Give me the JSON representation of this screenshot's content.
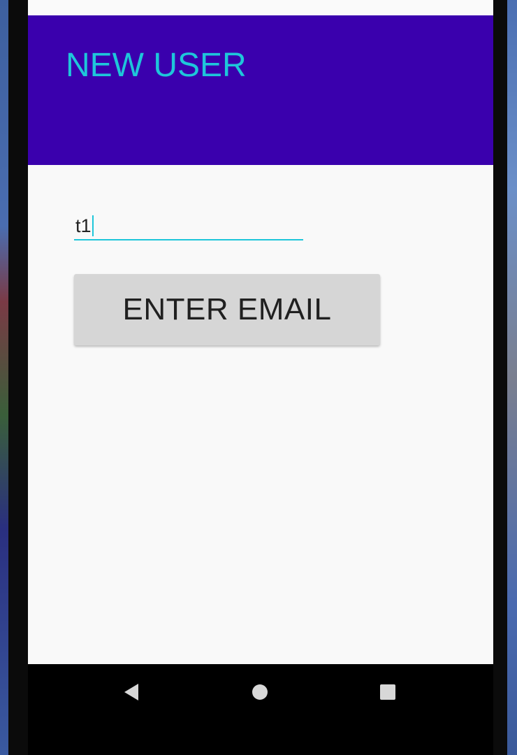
{
  "app": {
    "title": "NEW USER"
  },
  "form": {
    "text_input_value": "t1",
    "enter_email_label": "ENTER EMAIL"
  },
  "navbar": {
    "back_icon": "back-icon",
    "home_icon": "home-icon",
    "recents_icon": "recents-icon"
  },
  "colors": {
    "toolbar_bg": "#3a00ad",
    "accent": "#1ec6da",
    "button_bg": "#d6d6d6",
    "screen_bg": "#f9f9f9"
  }
}
